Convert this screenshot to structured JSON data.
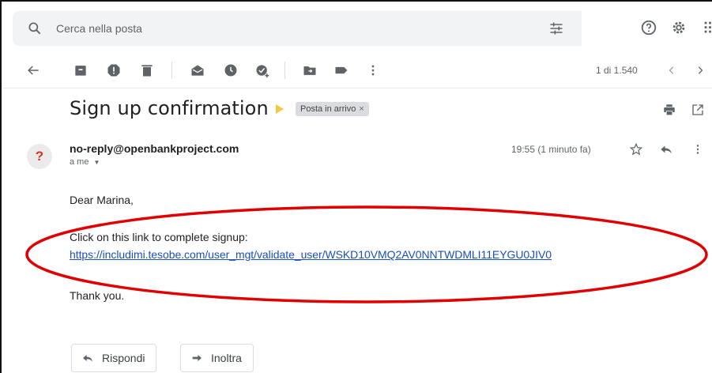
{
  "search": {
    "placeholder": "Cerca nella posta"
  },
  "toolbar": {
    "page_count": "1 di 1.540"
  },
  "message": {
    "subject": "Sign up confirmation",
    "label": "Posta in arrivo",
    "label_remove": "×",
    "avatar_letter": "?",
    "sender": "no-reply@openbankproject.com",
    "recipient": "a me",
    "timestamp": "19:55 (1 minuto fa)",
    "greeting": "Dear Marina,",
    "instruction": "Click on this link to complete signup:",
    "link": "https://includimi.tesobe.com/user_mgt/validate_user/WSKD10VMQ2AV0NNTWDMLI11EYGU0JIV0",
    "closing": "Thank you."
  },
  "actions": {
    "reply": "Rispondi",
    "forward": "Inoltra"
  },
  "colors": {
    "link": "#1a4fbd",
    "annotation": "#e00000",
    "important": "#f4c842",
    "avatar_text": "#d93025"
  },
  "icons": [
    "search-icon",
    "tune-icon",
    "help-icon",
    "settings-icon",
    "apps-icon",
    "back-icon",
    "archive-icon",
    "report-spam-icon",
    "delete-icon",
    "mark-unread-icon",
    "snooze-icon",
    "add-task-icon",
    "move-to-icon",
    "label-icon",
    "more-icon",
    "prev-icon",
    "next-icon",
    "print-icon",
    "open-new-window-icon",
    "star-icon",
    "reply-icon",
    "more-vert-icon"
  ]
}
